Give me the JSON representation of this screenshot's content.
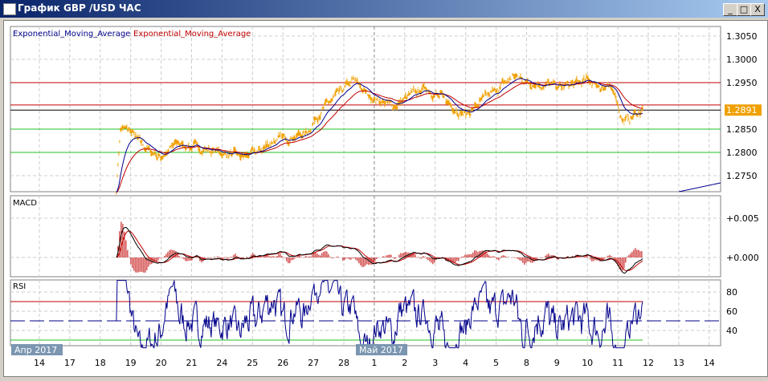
{
  "window": {
    "title": "График GBP /USD  ЧАС",
    "minimize": "_",
    "maximize": "□",
    "close": "X"
  },
  "legend": {
    "ema1": "Exponential_Moving_Average",
    "ema2": "Exponential_Moving_Average"
  },
  "panels": {
    "macd": "MACD",
    "rsi": "RSI"
  },
  "colors": {
    "price": "#f0a000",
    "ema_fast": "#00008b",
    "ema_slow": "#c00000",
    "resist": "#c00000",
    "support": "#20c020",
    "current": "#000000",
    "rsi_ob": "#ff00ff"
  },
  "chart_data": {
    "type": "line",
    "price_axis": {
      "ticks": [
        "1.3050",
        "1.3000",
        "1.2950",
        "1.2850",
        "1.2800",
        "1.2750"
      ],
      "ylim": [
        1.2715,
        1.307
      ]
    },
    "current_price": "1.2891",
    "levels": {
      "resistance": [
        1.295,
        1.2902
      ],
      "support": [
        1.285,
        1.28
      ],
      "current": 1.2891
    },
    "macd_axis": [
      "+0.005",
      "+0.000"
    ],
    "rsi_axis": [
      "80",
      "60",
      "40"
    ],
    "rsi_levels": [
      70,
      50,
      30
    ],
    "month_labels": [
      "Апр 2017",
      "Май 2017"
    ],
    "date_ticks": [
      "14",
      "17",
      "18",
      "19",
      "20",
      "21",
      "24",
      "25",
      "26",
      "27",
      "28",
      "1",
      "2",
      "3",
      "4",
      "5",
      "8",
      "9",
      "10",
      "11",
      "12",
      "13",
      "14"
    ],
    "price_keypoints": [
      [
        2.53,
        1.272
      ],
      [
        2.66,
        1.285
      ],
      [
        2.93,
        1.285
      ],
      [
        3.46,
        1.281
      ],
      [
        3.98,
        1.279
      ],
      [
        4.51,
        1.282
      ],
      [
        5.57,
        1.2805
      ],
      [
        6.62,
        1.279
      ],
      [
        7.15,
        1.28
      ],
      [
        7.68,
        1.2825
      ],
      [
        8.73,
        1.284
      ],
      [
        9.26,
        1.289
      ],
      [
        10.32,
        1.2955
      ],
      [
        10.84,
        1.292
      ],
      [
        11.64,
        1.29
      ],
      [
        12.69,
        1.294
      ],
      [
        13.48,
        1.2905
      ],
      [
        14.01,
        1.288
      ],
      [
        14.54,
        1.291
      ],
      [
        15.59,
        1.2965
      ],
      [
        16.12,
        1.295
      ],
      [
        17.18,
        1.294
      ],
      [
        18.0,
        1.2955
      ],
      [
        18.9,
        1.293
      ],
      [
        19.16,
        1.2865
      ],
      [
        19.82,
        1.2891
      ]
    ]
  }
}
